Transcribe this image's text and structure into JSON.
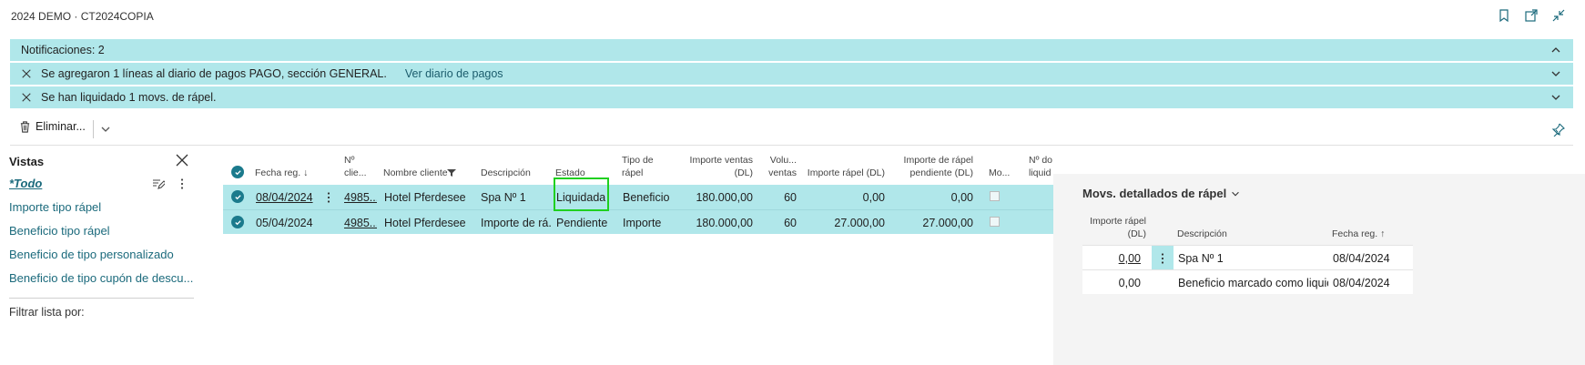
{
  "window": {
    "title": "2024 DEMO · CT2024COPIA",
    "icons": [
      "bookmark-icon",
      "open-new-window-icon",
      "collapse-icon"
    ]
  },
  "notifications": {
    "summary": "Notificaciones: 2",
    "items": [
      {
        "text": "Se agregaron 1 líneas al diario de pagos PAGO, sección GENERAL.",
        "link": "Ver diario de pagos"
      },
      {
        "text": "Se han liquidado 1 movs. de rápel.",
        "link": ""
      }
    ]
  },
  "actions": {
    "delete_label": "Eliminar..."
  },
  "views": {
    "title": "Vistas",
    "items": [
      {
        "label": "*Todo",
        "active": true
      },
      {
        "label": "Importe tipo rápel"
      },
      {
        "label": "Beneficio tipo rápel"
      },
      {
        "label": "Beneficio de tipo personalizado"
      },
      {
        "label": "Beneficio de tipo cupón de descu..."
      }
    ],
    "filter_label": "Filtrar lista por:"
  },
  "grid": {
    "columns": {
      "fecha": "Fecha reg. ↓",
      "no_cliente_1": "Nº",
      "no_cliente_2": "clie...",
      "nombre": "Nombre cliente",
      "descripcion": "Descripción",
      "estado": "Estado",
      "tipo_1": "Tipo de",
      "tipo_2": "rápel",
      "importe_ventas_1": "Importe ventas",
      "importe_ventas_2": "(DL)",
      "volumen_1": "Volu...",
      "volumen_2": "ventas",
      "importe_rapel": "Importe rápel (DL)",
      "pendiente_1": "Importe de rápel",
      "pendiente_2": "pendiente (DL)",
      "mo": "Mo...",
      "no_doc_1": "Nº do",
      "no_doc_2": "liquid"
    },
    "rows": [
      {
        "fecha": "08/04/2024",
        "no_cliente": "4985...",
        "nombre": "Hotel Pferdesee",
        "descripcion": "Spa Nº 1",
        "estado": "Liquidada",
        "tipo": "Beneficio",
        "importe_ventas": "180.000,00",
        "volumen": "60",
        "importe_rapel": "0,00",
        "pendiente": "0,00"
      },
      {
        "fecha": "05/04/2024",
        "no_cliente": "4985...",
        "nombre": "Hotel Pferdesee",
        "descripcion": "Importe de rá...",
        "estado": "Pendiente",
        "tipo": "Importe",
        "importe_ventas": "180.000,00",
        "volumen": "60",
        "importe_rapel": "27.000,00",
        "pendiente": "27.000,00"
      }
    ]
  },
  "factbox": {
    "title": "Movs. detallados de rápel",
    "columns": {
      "importe_1": "Importe rápel",
      "importe_2": "(DL)",
      "descripcion": "Descripción",
      "fecha": "Fecha reg. ↑"
    },
    "rows": [
      {
        "importe": "0,00",
        "descripcion": "Spa Nº 1",
        "fecha": "08/04/2024"
      },
      {
        "importe": "0,00",
        "descripcion": "Beneficio marcado como liquid...",
        "fecha": "08/04/2024"
      }
    ]
  },
  "colors": {
    "accent": "#1b6a7c",
    "selection": "#b0e7ea",
    "highlight_box": "#20d020"
  }
}
